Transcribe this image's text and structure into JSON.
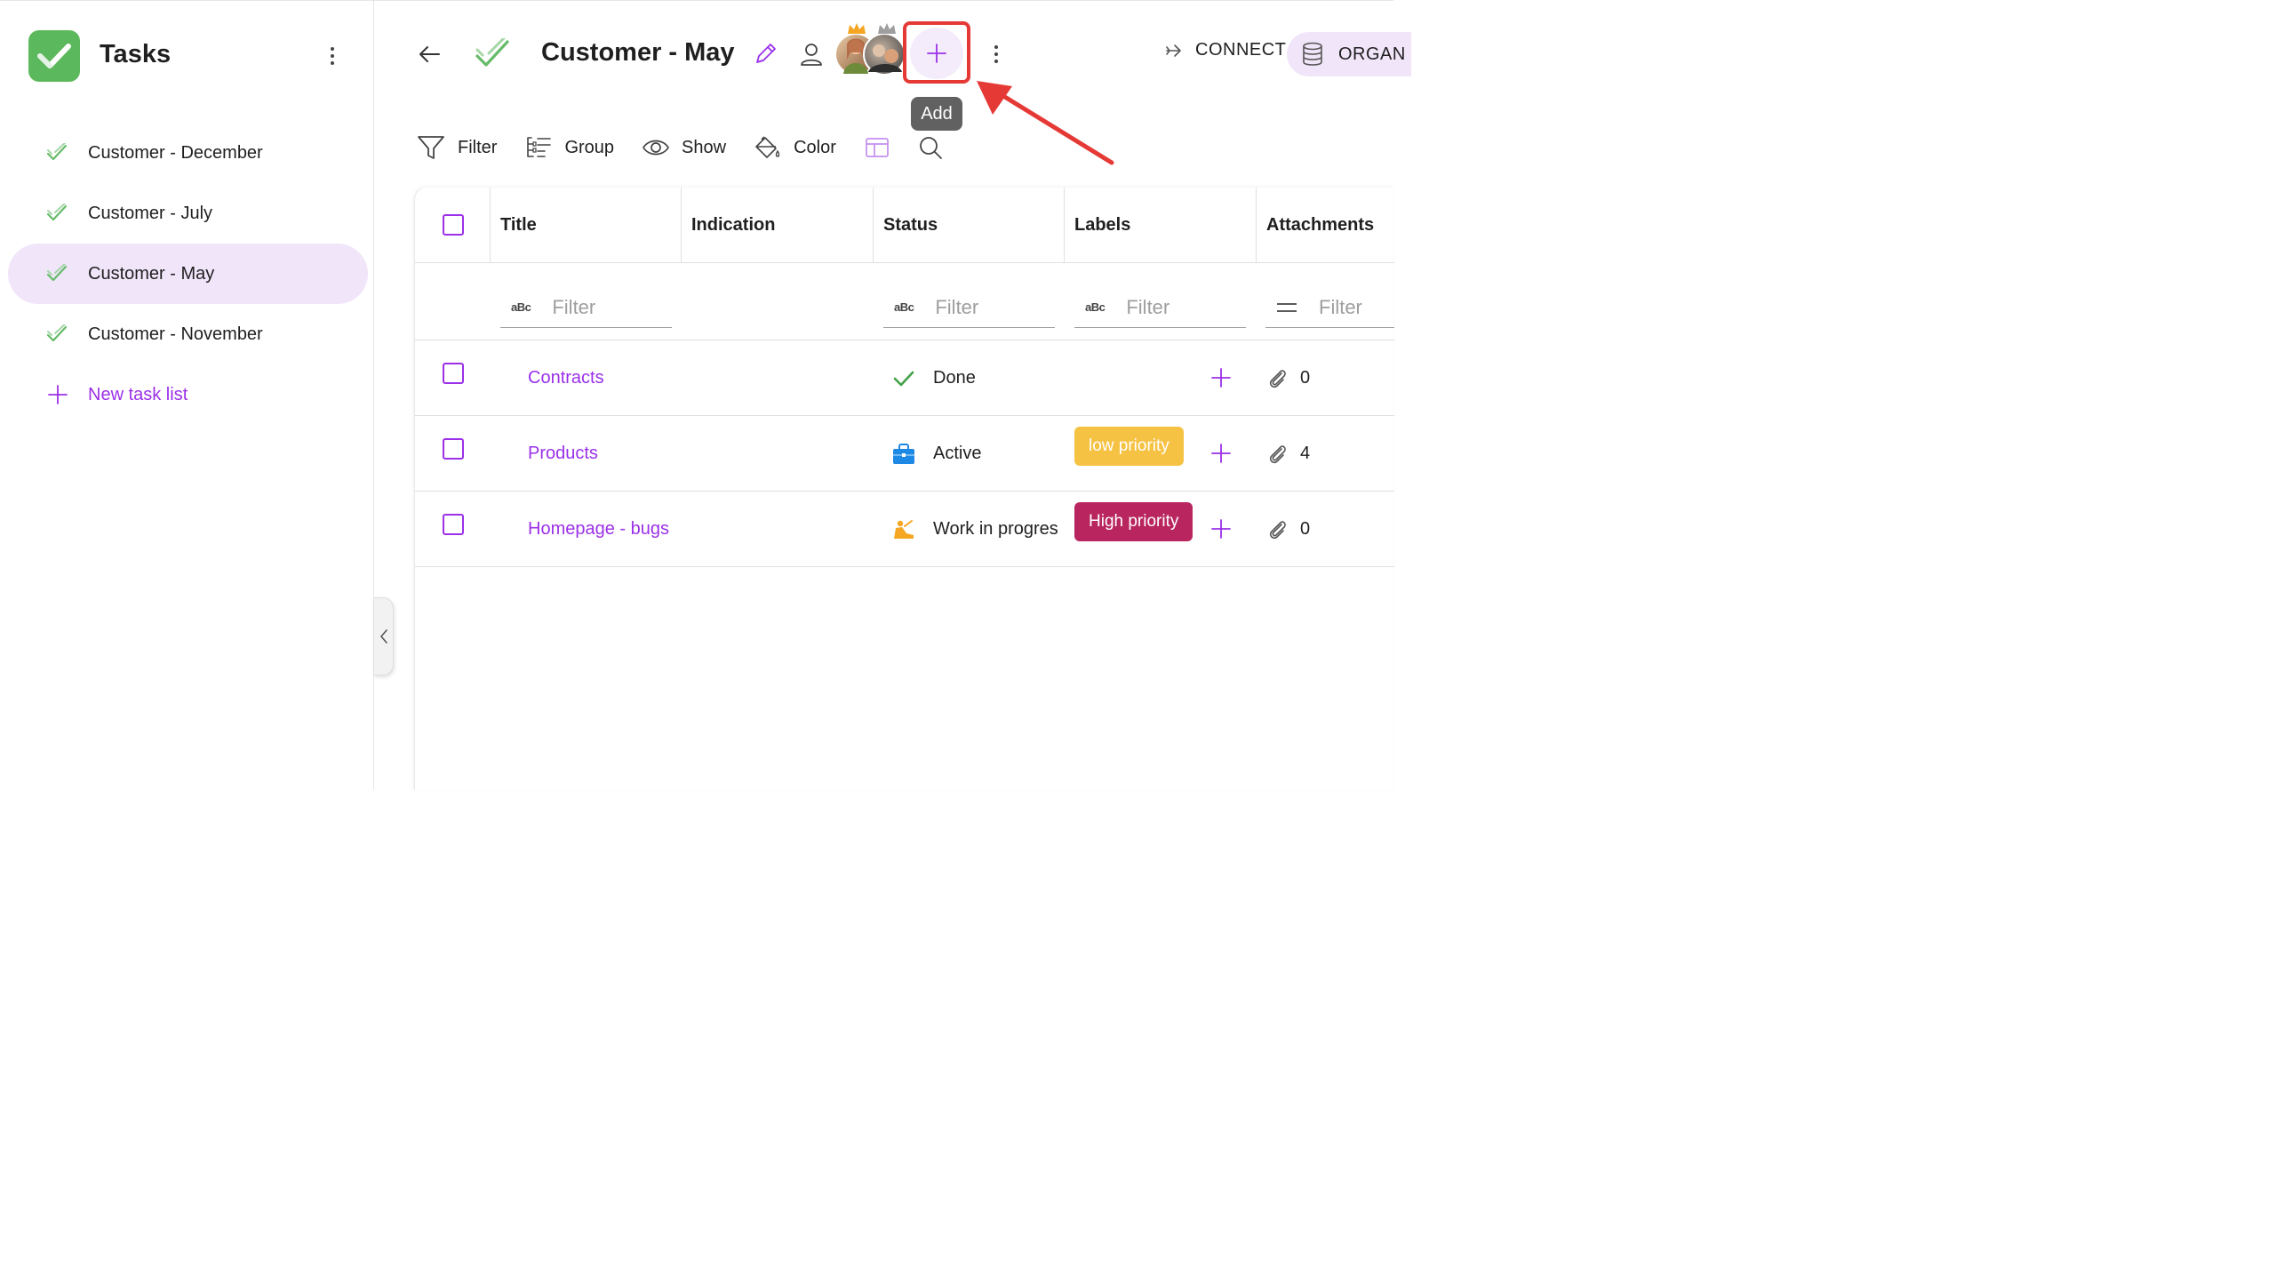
{
  "sidebar": {
    "app_title": "Tasks",
    "items": [
      {
        "label": "Customer - December"
      },
      {
        "label": "Customer - July"
      },
      {
        "label": "Customer - May"
      },
      {
        "label": "Customer - November"
      }
    ],
    "new_list_label": "New task list"
  },
  "header": {
    "title": "Customer - May",
    "add_tooltip": "Add",
    "connect_label": "CONNECT",
    "organize_label": "ORGAN"
  },
  "toolbar": {
    "filter_label": "Filter",
    "group_label": "Group",
    "show_label": "Show",
    "color_label": "Color"
  },
  "table": {
    "columns": [
      "Title",
      "Indication",
      "Status",
      "Labels",
      "Attachments"
    ],
    "filter_placeholder": "Filter",
    "rows": [
      {
        "title": "Contracts",
        "status": "Done",
        "label": "",
        "attachments": "0"
      },
      {
        "title": "Products",
        "status": "Active",
        "label": "low priority",
        "attachments": "4"
      },
      {
        "title": "Homepage - bugs",
        "status": "Work in progres",
        "label": "High priority",
        "attachments": "0"
      }
    ]
  },
  "colors": {
    "accent": "#9b30e8",
    "done_green": "#43a047",
    "low_priority": "#f6c244",
    "high_priority": "#b8255f",
    "highlight_red": "#e53935"
  }
}
